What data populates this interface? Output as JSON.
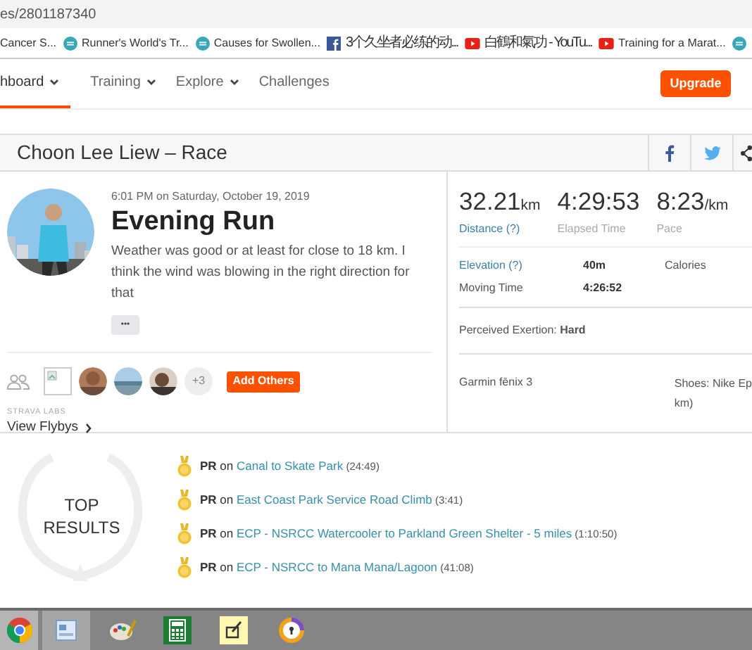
{
  "address_bar": {
    "url": "es/2801187340"
  },
  "bookmarks": [
    {
      "kind": "none",
      "label": "Cancer S..."
    },
    {
      "kind": "rw",
      "label": "Runner's World's Tr..."
    },
    {
      "kind": "rw",
      "label": "Causes for Swollen..."
    },
    {
      "kind": "facebook",
      "label": "3个久坐者必练的动..."
    },
    {
      "kind": "youtube",
      "label": "白鶴和氣功 - YouTu..."
    },
    {
      "kind": "youtube",
      "label": "Training for a Marat..."
    },
    {
      "kind": "rw"
    }
  ],
  "nav": {
    "items": [
      {
        "label": "hboard",
        "dropdown": true,
        "selected": true
      },
      {
        "label": "Training",
        "dropdown": true,
        "selected": false
      },
      {
        "label": "Explore",
        "dropdown": true,
        "selected": false
      },
      {
        "label": "Challenges",
        "dropdown": false,
        "selected": false
      }
    ],
    "upgrade_button": "Upgrade"
  },
  "page_title": "Choon Lee Liew – Race",
  "activity": {
    "time": "6:01 PM on Saturday, October 19, 2019",
    "title": "Evening Run",
    "description": "Weather was good or at least for close to 18 km. I think the wind was blowing in the right direction for that",
    "more_button": "•••",
    "others_count": "+3",
    "add_others_button": "Add Others",
    "labs_label": "STRAVA LABS",
    "flybys_link": "View Flybys"
  },
  "stats": {
    "primary": [
      {
        "value": "32.21",
        "unit": "km",
        "label": "Distance (?)",
        "link": true
      },
      {
        "value": "4:29:53",
        "label": "Elapsed Time",
        "link": false
      },
      {
        "value": "8:23",
        "unit": "/km",
        "label": "Pace",
        "link": false
      }
    ],
    "secondary": [
      {
        "label": "Elevation (?)",
        "value": "40m",
        "link": true
      },
      {
        "label": "Calories",
        "link": false
      },
      {
        "label": "Moving Time",
        "value": "4:26:52",
        "link": false
      }
    ],
    "perceived_exertion": "Perceived Exertion: **Hard**",
    "device": "Garmin fēnix 3",
    "shoes_lines": [
      "Shoes: Nike Ep",
      "km)"
    ]
  },
  "top_results": {
    "heading": "TOP RESULTS",
    "items": [
      {
        "badge": "PR",
        "on": "on",
        "segment": "Canal to Skate Park",
        "time": "(24:49)"
      },
      {
        "badge": "PR",
        "on": "on",
        "segment": "East Coast Park Service Road Climb",
        "time": "(3:41)"
      },
      {
        "badge": "PR",
        "on": "on",
        "segment": "ECP - NSRCC Watercooler to Parkland Green Shelter - 5 miles",
        "time": "(1:10:50)"
      },
      {
        "badge": "PR",
        "on": "on",
        "segment": "ECP - NSRCC to Mana Mana/Lagoon",
        "time": "(41:08)"
      }
    ]
  }
}
